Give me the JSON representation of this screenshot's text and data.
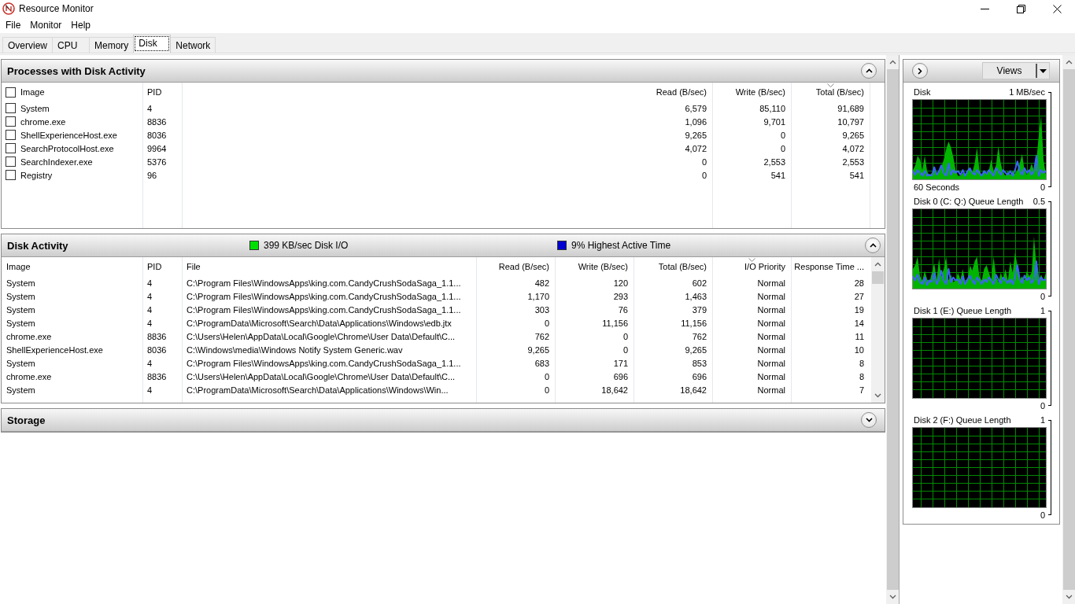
{
  "window": {
    "title": "Resource Monitor"
  },
  "menu": [
    "File",
    "Monitor",
    "Help"
  ],
  "tabs": [
    {
      "label": "Overview",
      "selected": false
    },
    {
      "label": "CPU",
      "selected": false
    },
    {
      "label": "Memory",
      "selected": false
    },
    {
      "label": "Disk",
      "selected": true
    },
    {
      "label": "Network",
      "selected": false
    }
  ],
  "processes": {
    "title": "Processes with Disk Activity",
    "expanded": true,
    "select_all_checked": false,
    "columns": [
      {
        "label": "Image",
        "sorted": false
      },
      {
        "label": "PID",
        "sorted": false
      },
      {
        "label": "Read (B/sec)",
        "sorted": false
      },
      {
        "label": "Write (B/sec)",
        "sorted": false
      },
      {
        "label": "Total (B/sec)",
        "sorted": true
      }
    ],
    "rows": [
      {
        "checked": false,
        "cells": [
          "System",
          "4",
          "6,579",
          "85,110",
          "91,689"
        ]
      },
      {
        "checked": false,
        "cells": [
          "chrome.exe",
          "8836",
          "1,096",
          "9,701",
          "10,797"
        ]
      },
      {
        "checked": false,
        "cells": [
          "ShellExperienceHost.exe",
          "8036",
          "9,265",
          "0",
          "9,265"
        ]
      },
      {
        "checked": false,
        "cells": [
          "SearchProtocolHost.exe",
          "9964",
          "4,072",
          "0",
          "4,072"
        ]
      },
      {
        "checked": false,
        "cells": [
          "SearchIndexer.exe",
          "5376",
          "0",
          "2,553",
          "2,553"
        ]
      },
      {
        "checked": false,
        "cells": [
          "Registry",
          "96",
          "0",
          "541",
          "541"
        ]
      }
    ]
  },
  "disk_activity": {
    "title": "Disk Activity",
    "expanded": true,
    "stats": [
      {
        "text": "399 KB/sec Disk I/O",
        "color": "#00e000"
      },
      {
        "text": "9% Highest Active Time",
        "color": "#0000d0"
      }
    ],
    "columns": [
      {
        "label": "Image",
        "sorted": false
      },
      {
        "label": "PID",
        "sorted": false
      },
      {
        "label": "File",
        "sorted": false
      },
      {
        "label": "Read (B/sec)",
        "sorted": false
      },
      {
        "label": "Write (B/sec)",
        "sorted": false
      },
      {
        "label": "Total (B/sec)",
        "sorted": false
      },
      {
        "label": "I/O Priority",
        "sorted": true
      },
      {
        "label": "Response Time ...",
        "sorted": false
      }
    ],
    "rows": [
      [
        "System",
        "4",
        "C:\\Program Files\\WindowsApps\\king.com.CandyCrushSodaSaga_1.1...",
        "482",
        "120",
        "602",
        "Normal",
        "28"
      ],
      [
        "System",
        "4",
        "C:\\Program Files\\WindowsApps\\king.com.CandyCrushSodaSaga_1.1...",
        "1,170",
        "293",
        "1,463",
        "Normal",
        "27"
      ],
      [
        "System",
        "4",
        "C:\\Program Files\\WindowsApps\\king.com.CandyCrushSodaSaga_1.1...",
        "303",
        "76",
        "379",
        "Normal",
        "19"
      ],
      [
        "System",
        "4",
        "C:\\ProgramData\\Microsoft\\Search\\Data\\Applications\\Windows\\edb.jtx",
        "0",
        "11,156",
        "11,156",
        "Normal",
        "14"
      ],
      [
        "chrome.exe",
        "8836",
        "C:\\Users\\Helen\\AppData\\Local\\Google\\Chrome\\User Data\\Default\\C...",
        "762",
        "0",
        "762",
        "Normal",
        "11"
      ],
      [
        "ShellExperienceHost.exe",
        "8036",
        "C:\\Windows\\media\\Windows Notify System Generic.wav",
        "9,265",
        "0",
        "9,265",
        "Normal",
        "10"
      ],
      [
        "System",
        "4",
        "C:\\Program Files\\WindowsApps\\king.com.CandyCrushSodaSaga_1.1...",
        "683",
        "171",
        "853",
        "Normal",
        "8"
      ],
      [
        "chrome.exe",
        "8836",
        "C:\\Users\\Helen\\AppData\\Local\\Google\\Chrome\\User Data\\Default\\C...",
        "0",
        "696",
        "696",
        "Normal",
        "8"
      ],
      [
        "System",
        "4",
        "C:\\ProgramData\\Microsoft\\Search\\Data\\Applications\\Windows\\Win...",
        "0",
        "18,642",
        "18,642",
        "Normal",
        "7"
      ]
    ]
  },
  "storage": {
    "title": "Storage",
    "expanded": false
  },
  "graph_pane": {
    "views_label": "Views",
    "graphs": [
      {
        "title": "Disk",
        "caption": "60 Seconds",
        "chart_data": [
          {
            "type": "area",
            "ylim": [
              0,
              1
            ],
            "yticks": [
              {
                "value": 0,
                "label": "0"
              },
              {
                "value": 1,
                "label": "1 MB/sec"
              }
            ],
            "series": [
              {
                "color": "#00b400",
                "values": [
                  0.18,
                  0.23,
                  0.33,
                  0.29,
                  0.18,
                  0.33,
                  0.17,
                  0.12,
                  0.15,
                  0.18,
                  0.12,
                  0.17,
                  0.21,
                  0.29,
                  0.4,
                  0.48,
                  0.42,
                  0.32,
                  0.18,
                  0.12,
                  0.12,
                  0.15,
                  0.13,
                  0.17,
                  0.21,
                  0.15,
                  0.25,
                  0.42,
                  0.18,
                  0.12,
                  0.17,
                  0.13,
                  0.18,
                  0.29,
                  0.17,
                  0.23,
                  0.43,
                  0.25,
                  0.15,
                  0.12,
                  0.17,
                  0.13,
                  0.17,
                  0.14,
                  0.18,
                  0.25,
                  0.35,
                  0.18,
                  0.13,
                  0.17,
                  0.25,
                  0.17,
                  0.27,
                  0.54,
                  0.75,
                  0.29,
                  0.13
                ]
              },
              {
                "type": "line",
                "color": "#3c62ff",
                "values": [
                  0.17,
                  0.13,
                  0.18,
                  0.15,
                  0.12,
                  0.17,
                  0.12,
                  0.13,
                  0.12,
                  0.21,
                  0.13,
                  0.17,
                  0.23,
                  0.15,
                  0.12,
                  0.25,
                  0.13,
                  0.18,
                  0.15,
                  0.17,
                  0.13,
                  0.18,
                  0.12,
                  0.17,
                  0.2,
                  0.15,
                  0.13,
                  0.18,
                  0.15,
                  0.12,
                  0.17,
                  0.14,
                  0.18,
                  0.15,
                  0.12,
                  0.2,
                  0.17,
                  0.13,
                  0.18,
                  0.15,
                  0.13,
                  0.17,
                  0.12,
                  0.18,
                  0.27,
                  0.17,
                  0.13,
                  0.2,
                  0.15,
                  0.18,
                  0.13,
                  0.17,
                  0.33,
                  0.12,
                  0.18,
                  0.15,
                  0.17
                ]
              }
            ]
          }
        ]
      },
      {
        "title": "Disk 0 (C: Q:) Queue Length",
        "chart_data": [
          {
            "type": "area",
            "ylim": [
              0,
              0.5
            ],
            "yticks": [
              {
                "value": 0,
                "label": "0"
              },
              {
                "value": 0.5,
                "label": "0.5"
              }
            ],
            "series": [
              {
                "color": "#00b400",
                "values": [
                  0.145,
                  0.165,
                  0.21,
                  0.105,
                  0.085,
                  0.135,
                  0.09,
                  0.075,
                  0.125,
                  0.175,
                  0.09,
                  0.2,
                  0.105,
                  0.145,
                  0.21,
                  0.085,
                  0.115,
                  0.075,
                  0.085,
                  0.125,
                  0.09,
                  0.145,
                  0.075,
                  0.09,
                  0.165,
                  0.135,
                  0.185,
                  0.21,
                  0.105,
                  0.085,
                  0.145,
                  0.165,
                  0.125,
                  0.09,
                  0.21,
                  0.105,
                  0.075,
                  0.125,
                  0.09,
                  0.145,
                  0.085,
                  0.185,
                  0.125,
                  0.23,
                  0.165,
                  0.09,
                  0.105,
                  0.085,
                  0.135,
                  0.105,
                  0.125,
                  0.315,
                  0.165,
                  0.09,
                  0.115,
                  0.085,
                  0.125
                ]
              },
              {
                "type": "line",
                "color": "#3c62ff",
                "values": [
                  0.105,
                  0.085,
                  0.115,
                  0.075,
                  0.065,
                  0.1,
                  0.06,
                  0.085,
                  0.075,
                  0.125,
                  0.065,
                  0.09,
                  0.135,
                  0.085,
                  0.065,
                  0.145,
                  0.075,
                  0.1,
                  0.085,
                  0.09,
                  0.065,
                  0.105,
                  0.065,
                  0.09,
                  0.11,
                  0.085,
                  0.065,
                  0.1,
                  0.085,
                  0.065,
                  0.09,
                  0.075,
                  0.1,
                  0.085,
                  0.065,
                  0.115,
                  0.09,
                  0.07,
                  0.1,
                  0.085,
                  0.07,
                  0.09,
                  0.065,
                  0.1,
                  0.165,
                  0.09,
                  0.07,
                  0.11,
                  0.085,
                  0.1,
                  0.07,
                  0.09,
                  0.185,
                  0.065,
                  0.1,
                  0.085,
                  0.09
                ]
              }
            ]
          }
        ]
      },
      {
        "title": "Disk 1 (E:) Queue Length",
        "max": "1",
        "min": "0"
      },
      {
        "title": "Disk 2 (F:) Queue Length",
        "max": "1",
        "min": "0"
      }
    ]
  }
}
